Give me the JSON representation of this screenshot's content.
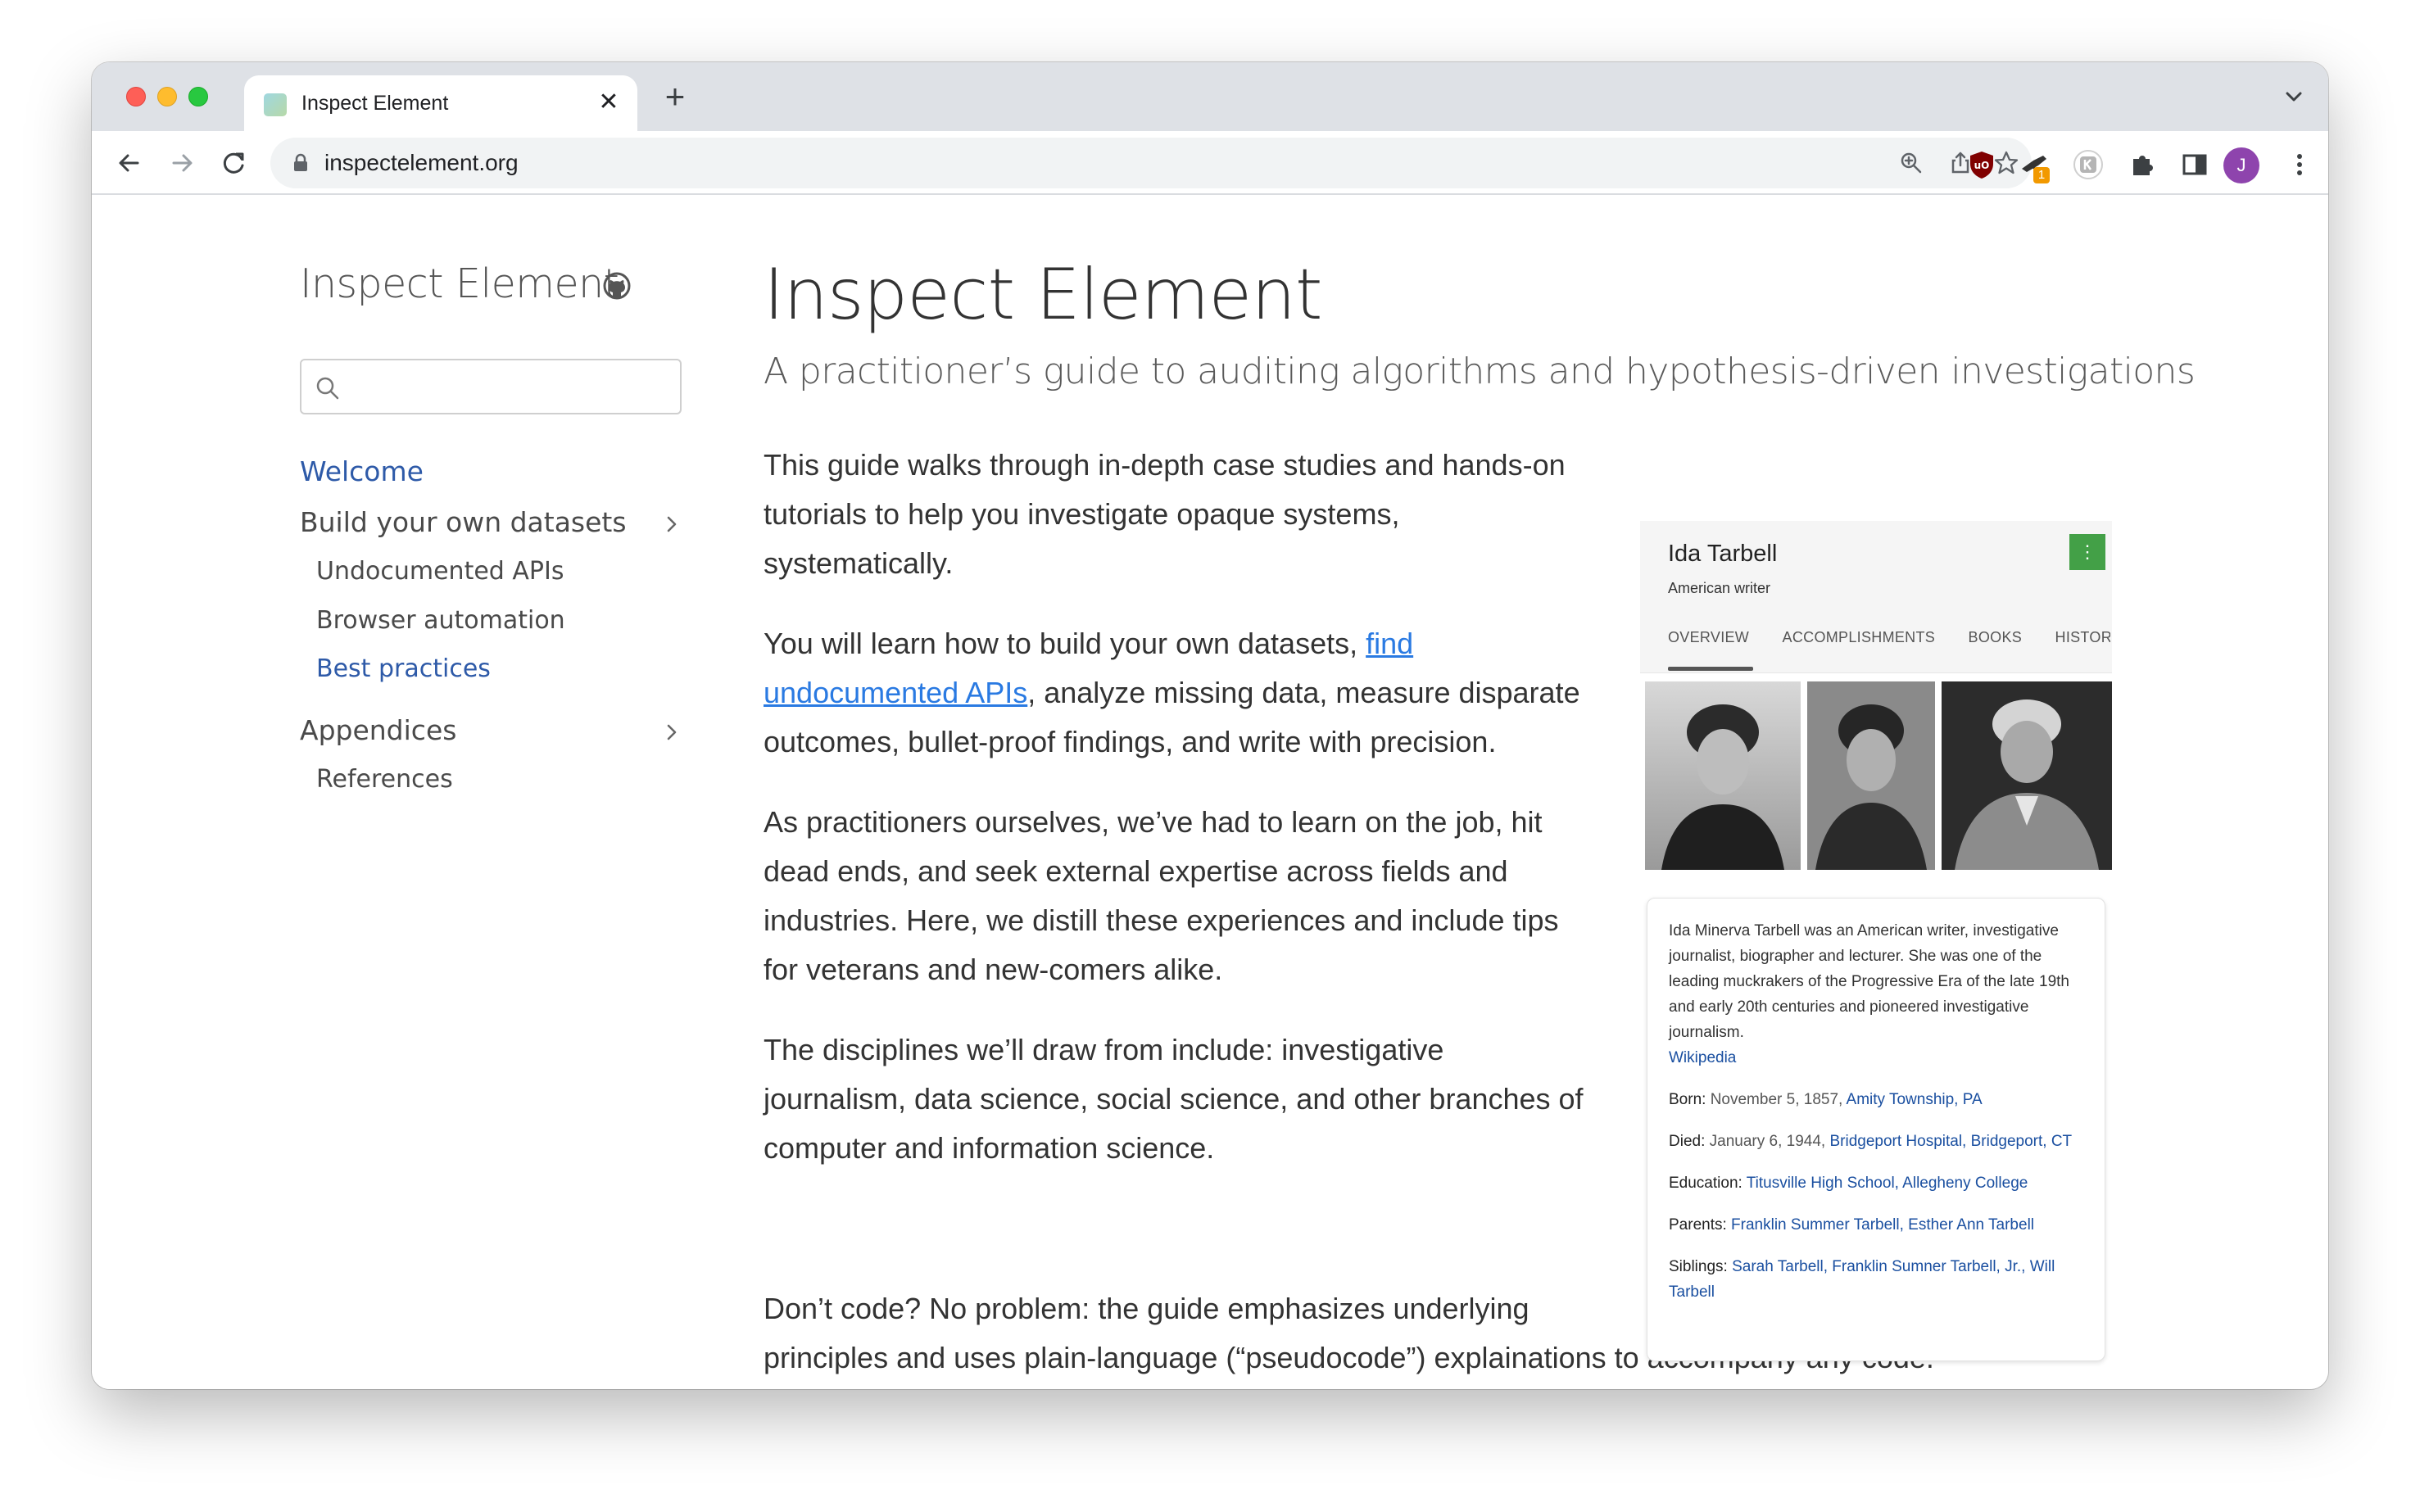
{
  "browser": {
    "tab_title": "Inspect Element",
    "close_glyph": "✕",
    "new_tab_glyph": "+",
    "url": "inspectelement.org",
    "profile_initial": "J",
    "extension_badge": "1"
  },
  "sidebar": {
    "site_title": "Inspect Element",
    "search_placeholder": "",
    "items": [
      {
        "label": "Welcome",
        "level": "main",
        "active": true,
        "has_chevron": false
      },
      {
        "label": "Build your own datasets",
        "level": "main",
        "active": false,
        "has_chevron": true
      },
      {
        "label": "Undocumented APIs",
        "level": "sub",
        "active": false,
        "has_chevron": false
      },
      {
        "label": "Browser automation",
        "level": "sub",
        "active": false,
        "has_chevron": false
      },
      {
        "label": "Best practices",
        "level": "sub",
        "active": true,
        "has_chevron": false
      },
      {
        "label": "Appendices",
        "level": "main",
        "active": false,
        "has_chevron": true
      },
      {
        "label": "References",
        "level": "sub",
        "active": false,
        "has_chevron": false
      }
    ]
  },
  "main": {
    "title": "Inspect Element",
    "subtitle": "A practitioner’s guide to auditing algorithms and hypothesis-driven investigations",
    "p1": "This guide walks through in-depth case studies and hands-on tutorials to help you investigate opaque systems, systematically.",
    "p2_before": "You will learn how to build your own datasets, ",
    "p2_link": "find undocumented APIs",
    "p2_after": ", analyze missing data, measure disparate outcomes, bullet-proof findings, and write with precision.",
    "p3": "As practitioners ourselves, we’ve had to learn on the job, hit dead ends, and seek external expertise across fields and industries. Here, we distill these experiences and include tips for veterans and new-comers alike.",
    "p4": "The disciplines we’ll draw from include: investigative journalism, data science, social science, and other branches of computer and information science.",
    "p5": "Don’t code? No problem: the guide emphasizes underlying principles and uses plain-language (“pseudocode”) explainations to accompany any code."
  },
  "knowledge_panel": {
    "name": "Ida Tarbell",
    "description": "American writer",
    "more_glyph": "⋮",
    "tabs": [
      "OVERVIEW",
      "ACCOMPLISHMENTS",
      "BOOKS",
      "HISTORY"
    ],
    "summary": "Ida Minerva Tarbell was an American writer, investigative journalist, biographer and lecturer. She was one of the leading muckrakers of the Progressive Era of the late 19th and early 20th centuries and pioneered investigative journalism.",
    "source": "Wikipedia",
    "born_label": "Born:",
    "born_date": "November 5, 1857,",
    "born_place": "Amity Township, PA",
    "died_label": "Died:",
    "died_date": "January 6, 1944,",
    "died_place": "Bridgeport Hospital, Bridgeport, CT",
    "education_label": "Education:",
    "education_value": "Titusville High School, Allegheny College",
    "parents_label": "Parents:",
    "parents_value": "Franklin Summer Tarbell, Esther Ann Tarbell",
    "siblings_label": "Siblings:",
    "siblings_value": "Sarah Tarbell, Franklin Sumner Tarbell, Jr., Will Tarbell"
  },
  "colors": {
    "link": "#2a7ae2",
    "nav_active": "#2e5aa8",
    "kp_link": "#1a4fa0",
    "kp_more_button": "#43a047",
    "avatar": "#8e44ad"
  }
}
